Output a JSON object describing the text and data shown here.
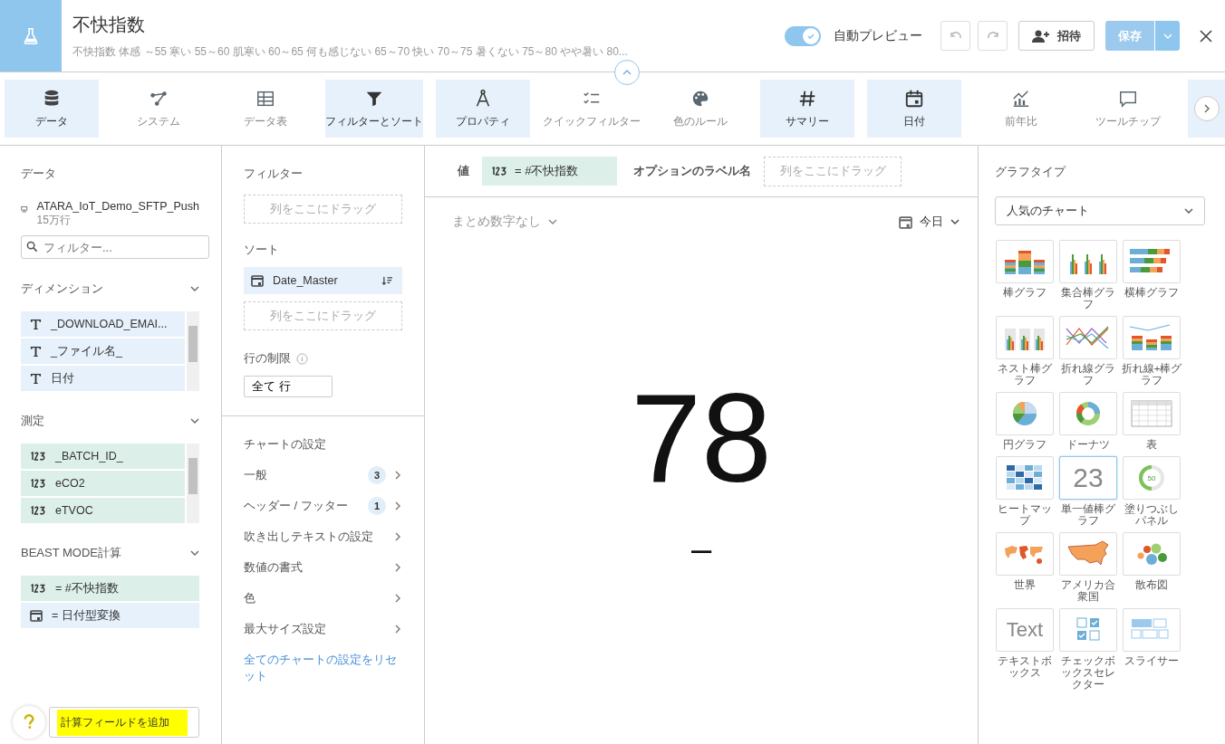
{
  "header": {
    "title": "不快指数",
    "description": "不快指数 体感 ～55 寒い 55～60 肌寒い 60～65 何も感じない 65～70 快い 70～75 暑くない 75～80 やや暑い 80...",
    "auto_preview": {
      "label": "自動プレビュー",
      "on": true
    },
    "invite": "招待",
    "save": "保存"
  },
  "toolbar": [
    {
      "label": "データ",
      "selected": true
    },
    {
      "label": "システム",
      "selected": false
    },
    {
      "label": "データ表",
      "selected": false
    },
    {
      "label": "フィルターとソート",
      "selected": true
    },
    {
      "label": "プロパティ",
      "selected": true
    },
    {
      "label": "クイックフィルター",
      "selected": false
    },
    {
      "label": "色のルール",
      "selected": false
    },
    {
      "label": "サマリー",
      "selected": true
    },
    {
      "label": "日付",
      "selected": true
    },
    {
      "label": "前年比",
      "selected": false
    },
    {
      "label": "ツールチップ",
      "selected": false
    },
    {
      "selected": true
    }
  ],
  "data_panel": {
    "heading": "データ",
    "dataset": "ATARA_IoT_Demo_SFTP_Push",
    "rows": "15万行",
    "filter_placeholder": "フィルター...",
    "sections": [
      {
        "title": "ディメンション",
        "scrollable": true,
        "items": [
          {
            "kind": "text",
            "label": "_DOWNLOAD_EMAI..."
          },
          {
            "kind": "text",
            "label": "_ファイル名_"
          },
          {
            "kind": "text",
            "label": "日付"
          }
        ]
      },
      {
        "title": "測定",
        "scrollable": true,
        "items": [
          {
            "kind": "number",
            "label": "_BATCH_ID_"
          },
          {
            "kind": "number",
            "label": "eCO2"
          },
          {
            "kind": "number",
            "label": "eTVOC"
          }
        ]
      },
      {
        "title": "BEAST MODE計算",
        "scrollable": false,
        "items": [
          {
            "kind": "number",
            "label": "= #不快指数"
          },
          {
            "kind": "date",
            "label": "= 日付型変換"
          }
        ]
      }
    ],
    "add_button": "計算フィールドを追加"
  },
  "filter_panel": {
    "filter_title": "フィルター",
    "filter_drop_hint": "列をここにドラッグ",
    "sort_title": "ソート",
    "sort_item": {
      "kind": "date",
      "label": "Date_Master"
    },
    "sort_drop_hint": "列をここにドラッグ",
    "limit_title": "行の制限",
    "limit_value": "全て 行",
    "chart_settings_title": "チャートの設定",
    "settings": [
      {
        "label": "一般",
        "count": "3"
      },
      {
        "label": "ヘッダー / フッター",
        "count": "1"
      },
      {
        "label": "吹き出しテキストの設定"
      },
      {
        "label": "数値の書式"
      },
      {
        "label": "色"
      },
      {
        "label": "最大サイズ設定"
      }
    ],
    "reset_link": "全てのチャートの設定をリセット"
  },
  "center": {
    "value_label": "値",
    "value_field": {
      "kind": "number",
      "label": "= #不快指数"
    },
    "option_label": "オプションのラベル名",
    "option_drop_hint": "列をここにドラッグ",
    "summary": "まとめ数字なし",
    "date_range": "今日",
    "big_value": "78",
    "comparison": "–"
  },
  "chart_types": {
    "title": "グラフタイプ",
    "dropdown": "人気のチャート",
    "types": [
      {
        "kind": "stacked-bar",
        "label": "棒グラフ",
        "selected": false
      },
      {
        "kind": "grouped-bar",
        "label": "集合棒グラフ",
        "selected": false
      },
      {
        "kind": "horizontal-bar",
        "label": "横棒グラフ",
        "selected": false
      },
      {
        "kind": "nested-bar",
        "label": "ネスト棒グラフ",
        "selected": false
      },
      {
        "kind": "line",
        "label": "折れ線グラフ",
        "selected": false
      },
      {
        "kind": "line-bar",
        "label": "折れ線+棒グラフ",
        "selected": false
      },
      {
        "kind": "pie",
        "label": "円グラフ",
        "selected": false
      },
      {
        "kind": "donut",
        "label": "ドーナツ",
        "selected": false
      },
      {
        "kind": "table",
        "label": "表",
        "selected": false
      },
      {
        "kind": "heatmap",
        "label": "ヒートマップ",
        "selected": false
      },
      {
        "kind": "single-value",
        "label": "単一値棒グラフ",
        "icon_text": "23",
        "selected": true
      },
      {
        "kind": "gauge",
        "label": "塗りつぶしパネル",
        "icon_text": "50",
        "selected": false
      },
      {
        "kind": "world-map",
        "label": "世界",
        "selected": false
      },
      {
        "kind": "us-map",
        "label": "アメリカ合衆国",
        "selected": false
      },
      {
        "kind": "scatter",
        "label": "散布図",
        "selected": false
      },
      {
        "kind": "textbox",
        "label": "テキストボックス",
        "icon_text": "Text",
        "selected": false
      },
      {
        "kind": "checkbox",
        "label": "チェックボックスセレクター",
        "selected": false
      },
      {
        "kind": "slicer",
        "label": "スライサー",
        "selected": false
      }
    ]
  }
}
